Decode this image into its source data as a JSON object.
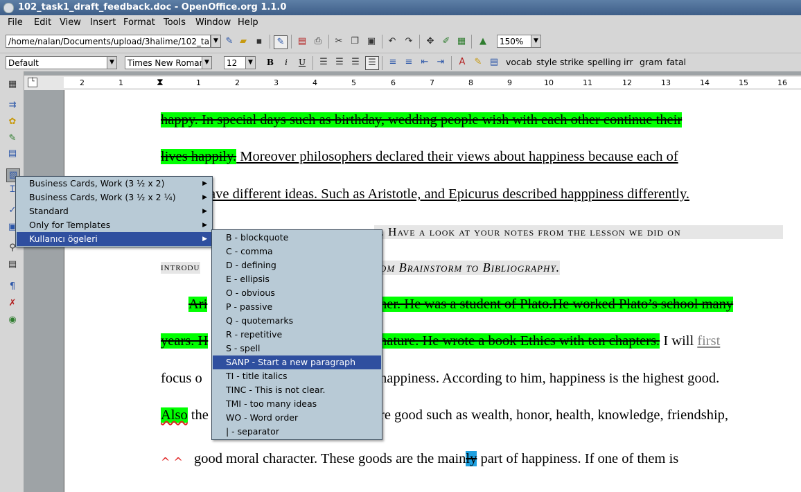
{
  "window": {
    "title": "102_task1_draft_feedback.doc - OpenOffice.org 1.1.0"
  },
  "menubar": [
    "File",
    "Edit",
    "View",
    "Insert",
    "Format",
    "Tools",
    "Window",
    "Help"
  ],
  "toolbar": {
    "path_value": "/home/nalan/Documents/upload/3halime/102_ta",
    "zoom_value": "150%"
  },
  "format_toolbar": {
    "style_value": "Default",
    "font_value": "Times New Roman",
    "size_value": "12",
    "bold": "B",
    "italic": "i",
    "underline": "U",
    "custom_buttons": [
      "vocab",
      "style",
      "strike",
      "spelling",
      "irr",
      "gram",
      "fatal"
    ]
  },
  "ruler": {
    "numbers": [
      "2",
      "1",
      "1",
      "2",
      "3",
      "4",
      "5",
      "6",
      "7",
      "8",
      "9",
      "10",
      "11",
      "12",
      "13",
      "14",
      "15",
      "16"
    ]
  },
  "document": {
    "line1": "happy. In special days such as birthday, wedding people wish with each  other continue their",
    "line2_hl": "lives happily.",
    "line2_rest": " Moreover philosophers declared their views about happiness because each of",
    "line3": "ave different ideas. Such as Aristotle, and Epicurus described  happpiness differently.",
    "line4_end": "g. Have a look at your notes from the lesson we did on",
    "line5_start": "introdu",
    "line5_end": "om Brainstorm to Bibliography.",
    "line6_a": "Ari",
    "line6_b": "her. He was a student of Plato.He worked Plato’s school many",
    "line7_a": "years. H",
    "line7_b": "nature. He wrote a book Ethics with ten chapters.",
    "line7_c": " I will ",
    "line7_d": "first",
    "line8_a": "focus o",
    "line8_b": "happiness. According to him,  happiness is the highest good.",
    "line9_a": "Also",
    "line9_b": " the",
    "line9_c": "re good such as wealth, honor, health, knowledge, friendship,",
    "line10_a": "good moral character. These goods are the main",
    "line10_b": "ly",
    "line10_c": " part of happiness. If one of them is",
    "carets": "^ ^"
  },
  "context_menu": {
    "items": [
      {
        "label": "Business Cards, Work (3 ½ x 2)"
      },
      {
        "label": "Business Cards, Work (3 ½ x 2 ¼)"
      },
      {
        "label": "Standard"
      },
      {
        "label": "Only for Templates"
      },
      {
        "label": "Kullanıcı ögeleri"
      }
    ]
  },
  "submenu": {
    "items": [
      {
        "label": "B - blockquote"
      },
      {
        "label": "C - comma"
      },
      {
        "label": "D - defining"
      },
      {
        "label": "E - ellipsis"
      },
      {
        "label": "O - obvious"
      },
      {
        "label": "P - passive"
      },
      {
        "label": "Q - quotemarks"
      },
      {
        "label": "R - repetitive"
      },
      {
        "label": "S - spell"
      },
      {
        "label": "SANP -  Start a new paragraph"
      },
      {
        "label": "TI - title italics"
      },
      {
        "label": "TINC - This is not clear."
      },
      {
        "label": "TMI - too many ideas"
      },
      {
        "label": "WO - Word order"
      },
      {
        "label": "| - separator"
      }
    ]
  }
}
